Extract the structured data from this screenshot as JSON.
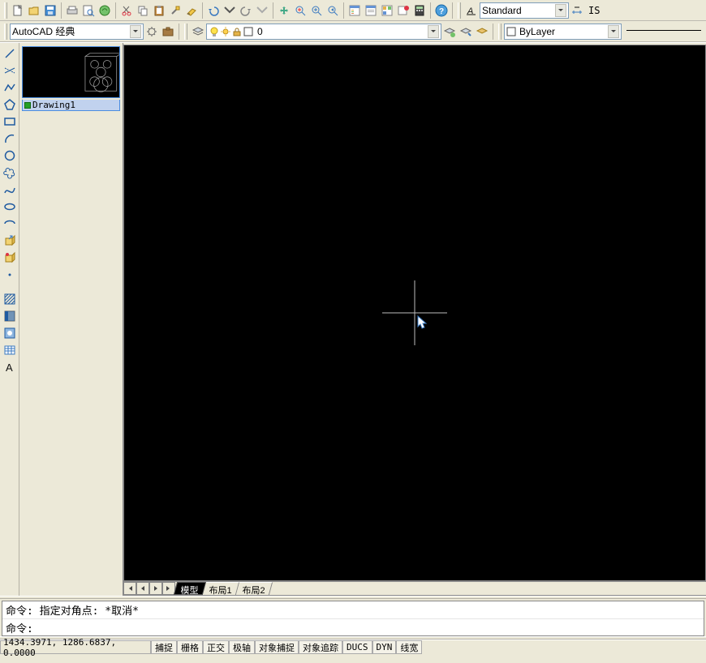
{
  "toolbar1": {
    "text_style": "Standard",
    "text_style_suffix": "IS"
  },
  "toolbar2": {
    "workspace": "AutoCAD 经典",
    "layer": "0",
    "bylayer": "ByLayer"
  },
  "thumbnail": {
    "name": "Drawing1"
  },
  "tabs": {
    "active": "模型",
    "layout1": "布局1",
    "layout2": "布局2"
  },
  "command": {
    "line1": "命令: 指定对角点: *取消*",
    "line2": "命令:"
  },
  "status": {
    "coords": "1434.3971, 1286.6837, 0.0000",
    "toggles": [
      "捕捉",
      "栅格",
      "正交",
      "极轴",
      "对象捕捉",
      "对象追踪",
      "DUCS",
      "DYN",
      "线宽"
    ]
  }
}
